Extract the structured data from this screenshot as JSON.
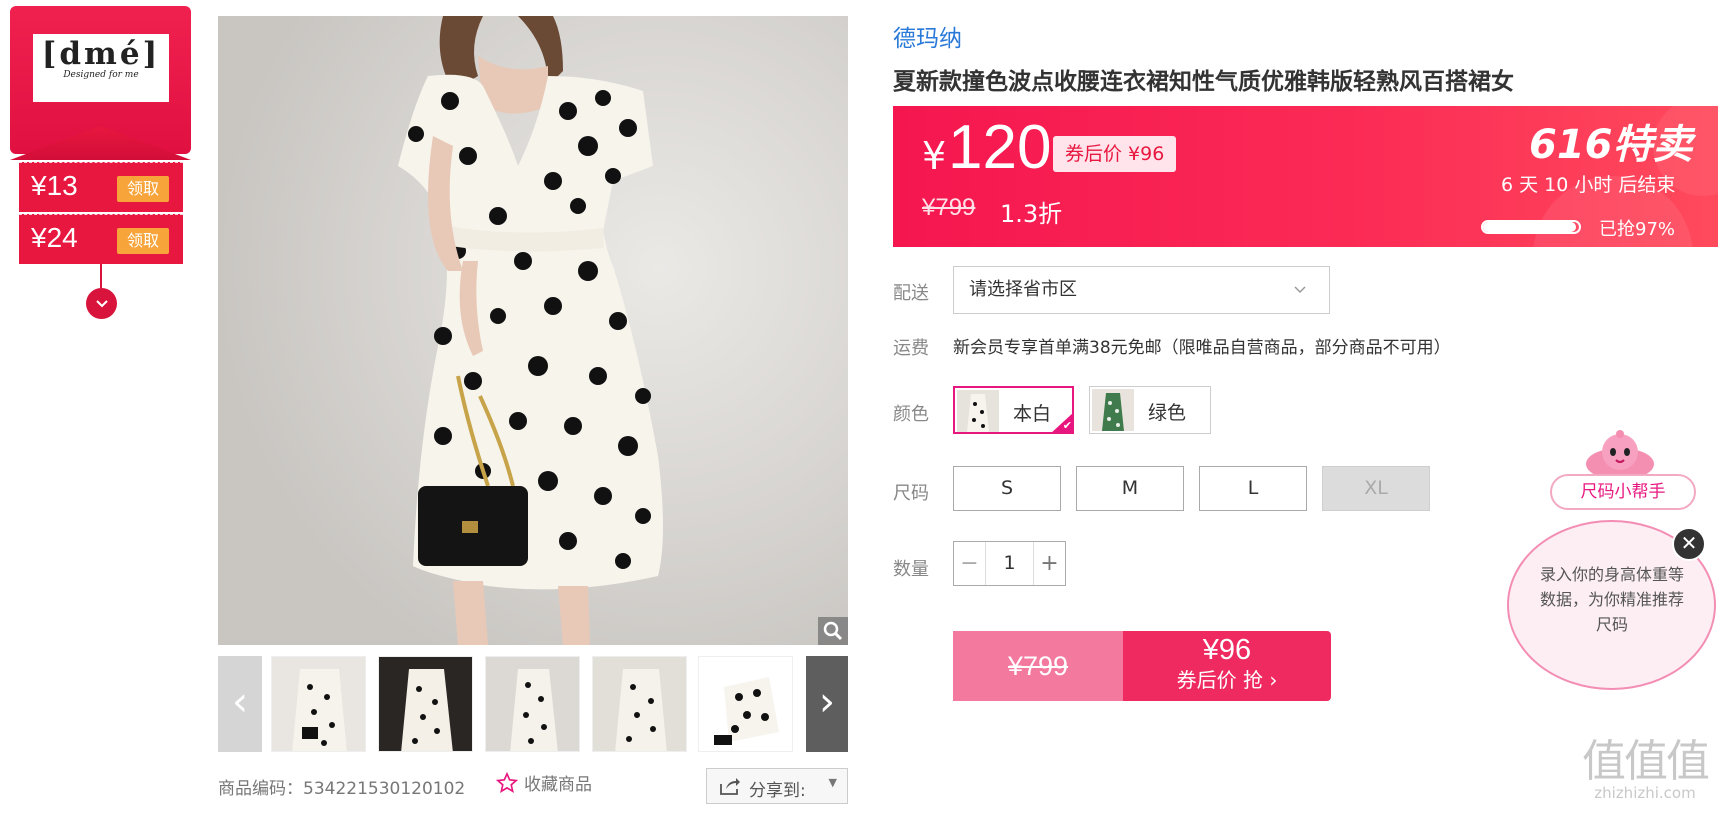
{
  "brand": {
    "logo_text": "[dmé]",
    "logo_tagline": "Designed for me"
  },
  "coupons": [
    {
      "amount": "¥13",
      "action": "领取"
    },
    {
      "amount": "¥24",
      "action": "领取"
    }
  ],
  "gallery": {
    "thumbnail_count": 6,
    "prev_arrow": "‹",
    "next_arrow": "›"
  },
  "product": {
    "shop_name": "德玛纳",
    "title": "夏新款撞色波点收腰连衣裙知性气质优雅韩版轻熟风百搭裙女",
    "sku_label": "商品编码：",
    "sku_code": "534221530120102",
    "favorite_label": "收藏商品",
    "share_label": "分享到:"
  },
  "price": {
    "currency": "¥",
    "current": "120",
    "coupon_price": "券后价 ¥96",
    "original": "¥799",
    "discount": "1.3折",
    "promo_logo": "616特卖",
    "countdown": "6 天 10 小时 后结束",
    "progress": 0.97,
    "progress_text": "已抢97%"
  },
  "delivery": {
    "label": "配送",
    "placeholder": "请选择省市区"
  },
  "shipping": {
    "label": "运费",
    "note": "新会员专享首单满38元免邮（限唯品自营商品，部分商品不可用）"
  },
  "colors": {
    "label": "颜色",
    "options": [
      {
        "name": "本白",
        "selected": true
      },
      {
        "name": "绿色",
        "selected": false
      }
    ]
  },
  "sizes": {
    "label": "尺码",
    "options": [
      {
        "name": "S",
        "available": true
      },
      {
        "name": "M",
        "available": true
      },
      {
        "name": "L",
        "available": true
      },
      {
        "name": "XL",
        "available": false
      }
    ]
  },
  "quantity": {
    "label": "数量",
    "minus": "−",
    "value": "1",
    "plus": "+"
  },
  "buy": {
    "original_price": "¥799",
    "price": "¥96",
    "label": "券后价 抢 ›"
  },
  "size_helper": {
    "title": "尺码小帮手",
    "text": "录入你的身高体重等数据，为你精准推荐尺码",
    "close": "✕"
  },
  "watermark": {
    "glyph": "值值值",
    "text": "zhizhizhi.com"
  },
  "colors_theme": {
    "accent": "#e8173f",
    "price_panel": "#f5164f",
    "link": "#2a79d8",
    "coupon_button": "#f7a53b"
  }
}
